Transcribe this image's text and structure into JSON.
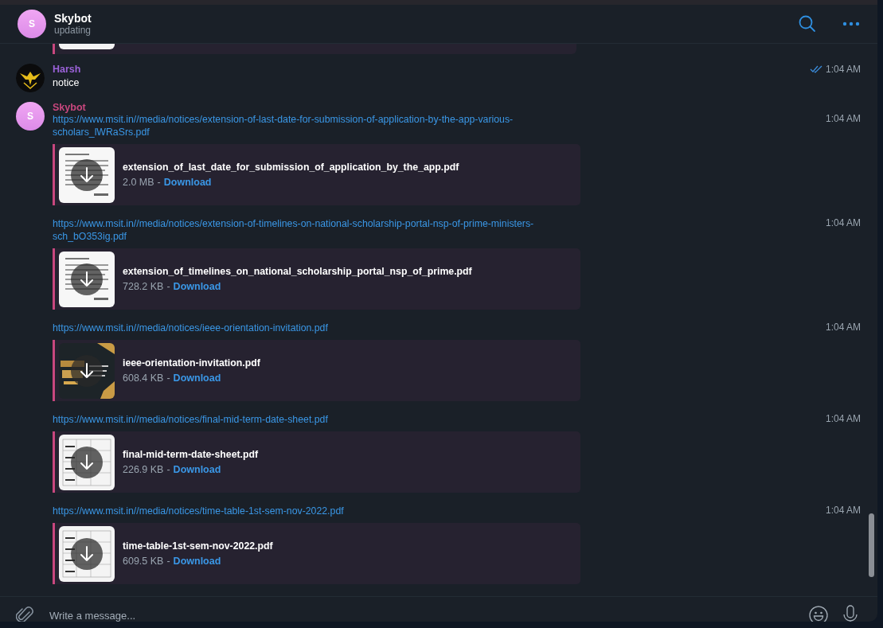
{
  "header": {
    "title": "Skybot",
    "status": "updating",
    "avatar_letter": "S"
  },
  "messages": [
    {
      "sender": "Harsh",
      "color": "#9b62d9",
      "kind": "emblem",
      "text": "notice",
      "time": "1:04 AM",
      "read": true
    },
    {
      "sender": "Skybot",
      "color": "#c8477e",
      "kind": "letter",
      "avatar_letter": "S",
      "posts": [
        {
          "link": "https://www.msit.in//media/notices/extension-of-last-date-for-submission-of-application-by-the-app-various-scholars_lWRaSrs.pdf",
          "time": "1:04 AM",
          "file": {
            "name": "extension_of_last_date_for_submission_of_application_by_the_app.pdf",
            "size": "2.0 MB",
            "separator": "-",
            "action": "Download",
            "kind": "letter"
          }
        },
        {
          "link": "https://www.msit.in//media/notices/extension-of-timelines-on-national-scholarship-portal-nsp-of-prime-ministers-sch_bO353ig.pdf",
          "time": "1:04 AM",
          "file": {
            "name": "extension_of_timelines_on_national_scholarship_portal_nsp_of_prime.pdf",
            "size": "728.2 KB",
            "separator": "-",
            "action": "Download",
            "kind": "letter"
          }
        },
        {
          "link": "https://www.msit.in//media/notices/ieee-orientation-invitation.pdf",
          "time": "1:04 AM",
          "file": {
            "name": "ieee-orientation-invitation.pdf",
            "size": "608.4 KB",
            "separator": "-",
            "action": "Download",
            "kind": "poster"
          }
        },
        {
          "link": "https://www.msit.in//media/notices/final-mid-term-date-sheet.pdf",
          "time": "1:04 AM",
          "file": {
            "name": "final-mid-term-date-sheet.pdf",
            "size": "226.9 KB",
            "separator": "-",
            "action": "Download",
            "kind": "table"
          }
        },
        {
          "link": "https://www.msit.in//media/notices/time-table-1st-sem-nov-2022.pdf",
          "time": "1:04 AM",
          "file": {
            "name": "time-table-1st-sem-nov-2022.pdf",
            "size": "609.5 KB",
            "separator": "-",
            "action": "Download",
            "kind": "table"
          }
        }
      ]
    }
  ],
  "composer": {
    "placeholder": "Write a message..."
  }
}
